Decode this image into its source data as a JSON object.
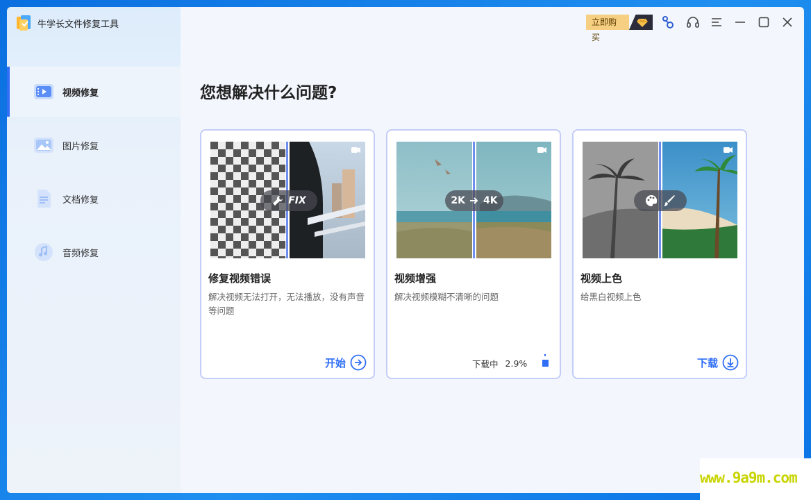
{
  "app": {
    "title": "牛学长文件修复工具"
  },
  "topbar": {
    "buy_label": "立即购买"
  },
  "sidebar": {
    "items": [
      {
        "label": "视频修复",
        "icon": "video-icon",
        "active": true
      },
      {
        "label": "图片修复",
        "icon": "image-icon",
        "active": false
      },
      {
        "label": "文档修复",
        "icon": "document-icon",
        "active": false
      },
      {
        "label": "音频修复",
        "icon": "audio-icon",
        "active": false
      }
    ]
  },
  "main": {
    "heading": "您想解决什么问题?",
    "cards": [
      {
        "title": "修复视频错误",
        "description": "解决视频无法打开，无法播放，没有声音等问题",
        "badge": "FIX",
        "action": "开始"
      },
      {
        "title": "视频增强",
        "description": "解决视频模糊不清晰的问题",
        "badge_from": "2K",
        "badge_to": "4K",
        "status_label": "下载中",
        "status_percent": "2.9%",
        "progress": 0.029
      },
      {
        "title": "视频上色",
        "description": "给黑白视频上色",
        "action": "下载"
      }
    ]
  },
  "watermark": "www.9a9m.com",
  "colors": {
    "accent": "#2f6ef5",
    "card_border": "#c4cdf7",
    "buy_bg": "#f6cf82"
  }
}
